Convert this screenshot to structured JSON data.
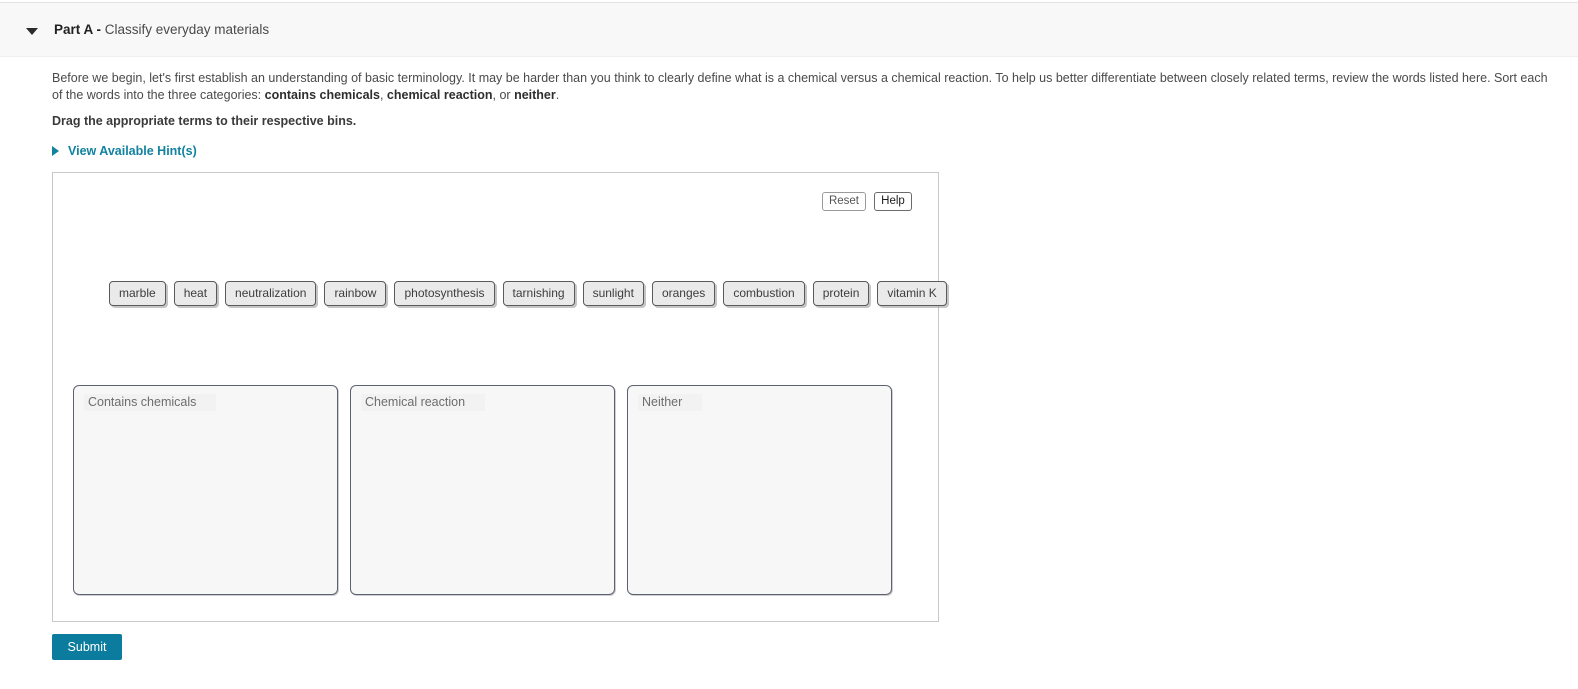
{
  "header": {
    "caret_icon": "caret-down-icon",
    "part_label": "Part A -",
    "part_name": " Classify everyday materials"
  },
  "prompt": {
    "paragraph_1": "Before we begin, let's first establish an understanding of basic terminology. It may be harder than you think to clearly define what is a chemical versus a chemical reaction. To help us better differentiate between closely related terms, review the words listed here. Sort each of the words into the three categories: ",
    "bold_1": "contains chemicals",
    "mid_1": ", ",
    "bold_2": "chemical reaction",
    "mid_2": ", or ",
    "bold_3": "neither",
    "tail": ".",
    "instruction": "Drag the appropriate terms to their respective bins."
  },
  "hints": {
    "caret_icon": "caret-right-icon",
    "label": "View Available Hint(s)"
  },
  "tools": {
    "reset_label": "Reset",
    "help_label": "Help"
  },
  "chips": [
    {
      "label": "marble"
    },
    {
      "label": "heat"
    },
    {
      "label": "neutralization"
    },
    {
      "label": "rainbow"
    },
    {
      "label": "photosynthesis"
    },
    {
      "label": "tarnishing"
    },
    {
      "label": "sunlight"
    },
    {
      "label": "oranges"
    },
    {
      "label": "combustion"
    },
    {
      "label": "protein"
    },
    {
      "label": "vitamin K"
    }
  ],
  "bins": [
    {
      "label": "Contains chemicals",
      "items": []
    },
    {
      "label": "Chemical reaction",
      "items": []
    },
    {
      "label": "Neither",
      "items": []
    }
  ],
  "submit": {
    "label": "Submit"
  },
  "colors": {
    "accent_teal": "#0b7c9e",
    "link_teal": "#11829f",
    "header_band": "#f8f8f8",
    "chip_fill": "#eaeaea",
    "bin_fill": "#f7f7f7"
  }
}
